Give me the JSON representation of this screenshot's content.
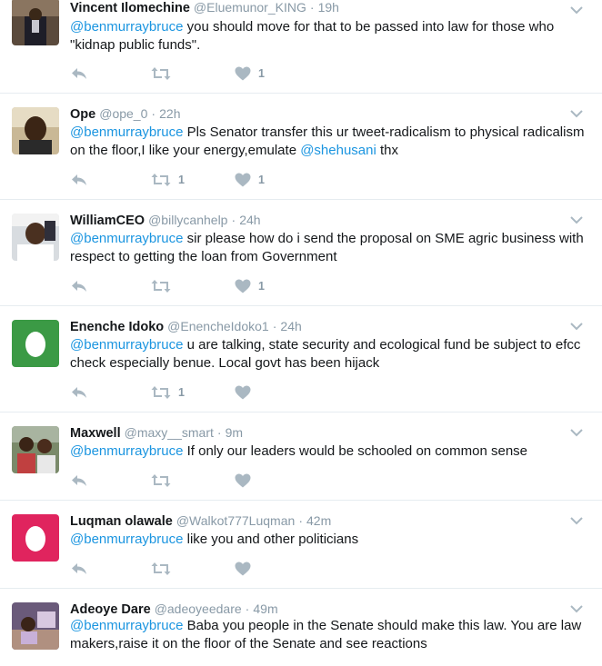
{
  "tweets": [
    {
      "name": "Vincent Ilomechine",
      "handle": "@Eluemunor_KING",
      "time": "19h",
      "mention": "@benmurraybruce",
      "text": " you should move for that to be passed into law for those who \"kidnap public funds\".",
      "retweets": "",
      "likes": "1",
      "avatar": "photo-suit"
    },
    {
      "name": "Ope",
      "handle": "@ope_0",
      "time": "22h",
      "mention": "@benmurraybruce",
      "text": " Pls Senator transfer this ur tweet-radicalism to physical radicalism on the floor,I like your energy,emulate ",
      "mention2": "@shehusani",
      "text2": " thx",
      "retweets": "1",
      "likes": "1",
      "avatar": "photo-man"
    },
    {
      "name": "WilliamCEO",
      "handle": "@billycanhelp",
      "time": "24h",
      "mention": "@benmurraybruce",
      "text": " sir please how do i send the proposal on SME agric business with respect to getting the loan from Government",
      "retweets": "",
      "likes": "1",
      "avatar": "photo-selfie"
    },
    {
      "name": "Enenche Idoko",
      "handle": "@EnencheIdoko1",
      "time": "24h",
      "mention": "@benmurraybruce",
      "text": " u are talking, state security and ecological fund be subject to efcc check especially benue. Local govt has been hijack",
      "retweets": "1",
      "likes": "",
      "avatar": "egg-green"
    },
    {
      "name": "Maxwell",
      "handle": "@maxy__smart",
      "time": "9m",
      "mention": "@benmurraybruce",
      "text": " If only our leaders would be schooled on common sense",
      "retweets": "",
      "likes": "",
      "avatar": "photo-group"
    },
    {
      "name": "Luqman olawale",
      "handle": "@Walkot777Luqman",
      "time": "42m",
      "mention": "@benmurraybruce",
      "text": " like you and other politicians",
      "retweets": "",
      "likes": "",
      "avatar": "egg-pink"
    },
    {
      "name": "Adeoye Dare",
      "handle": "@adeoyeedare",
      "time": "49m",
      "mention": "@benmurraybruce",
      "text": " Baba you people in the Senate should make this law. You are law makers,raise it on the floor of the Senate and see reactions",
      "retweets": "",
      "likes": "",
      "avatar": "photo-room"
    }
  ],
  "colors": {
    "name": "#14171a",
    "meta": "#8899a6",
    "mention": "#1b95e0",
    "egg_green": "#3b9a45",
    "egg_pink": "#e0245e",
    "divider": "#e6ecf0"
  }
}
